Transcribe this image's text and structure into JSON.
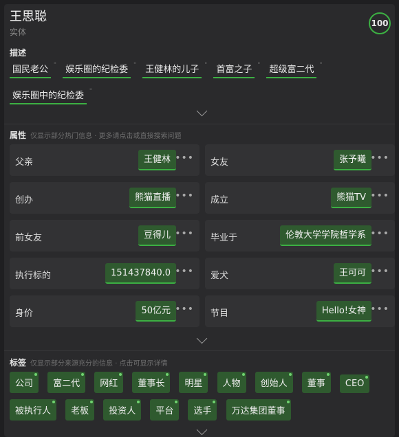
{
  "entity": {
    "name": "王思聪",
    "type": "实体",
    "score": "100"
  },
  "description": {
    "label": "描述",
    "items": [
      "国民老公",
      "娱乐圈的纪检委",
      "王健林的儿子",
      "首富之子",
      "超级富二代",
      "娱乐圈中的纪检委"
    ]
  },
  "attributes": {
    "label": "属性",
    "hint": "仅显示部分热门信息 · 更多请点击或直接搜索问题",
    "rows": [
      [
        {
          "label": "父亲",
          "value": "王健林"
        },
        {
          "label": "女友",
          "value": "张予曦"
        }
      ],
      [
        {
          "label": "创办",
          "value": "熊猫直播"
        },
        {
          "label": "成立",
          "value": "熊猫TV"
        }
      ],
      [
        {
          "label": "前女友",
          "value": "豆得儿"
        },
        {
          "label": "毕业于",
          "value": "伦敦大学学院哲学系"
        }
      ],
      [
        {
          "label": "执行标的",
          "value": "151437840.0"
        },
        {
          "label": "爱犬",
          "value": "王可可"
        }
      ],
      [
        {
          "label": "身价",
          "value": "50亿元"
        },
        {
          "label": "节目",
          "value": "Hello!女神"
        }
      ]
    ],
    "more_icon": "•••"
  },
  "tags": {
    "label": "标签",
    "hint": "仅显示部分来源充分的信息 · 点击可显示详情",
    "row1": [
      "公司",
      "富二代",
      "网红",
      "董事长",
      "明星",
      "人物",
      "创始人",
      "董事",
      "CEO"
    ],
    "row2": [
      "被执行人",
      "老板",
      "投资人",
      "平台",
      "选手",
      "万达集团董事"
    ]
  },
  "colors": {
    "accent": "#3cb043",
    "chip": "#2f5a2f",
    "panel": "#2a2a2c"
  },
  "icons": {
    "expand": "chevron-down-icon",
    "more": "more-dots-icon"
  }
}
